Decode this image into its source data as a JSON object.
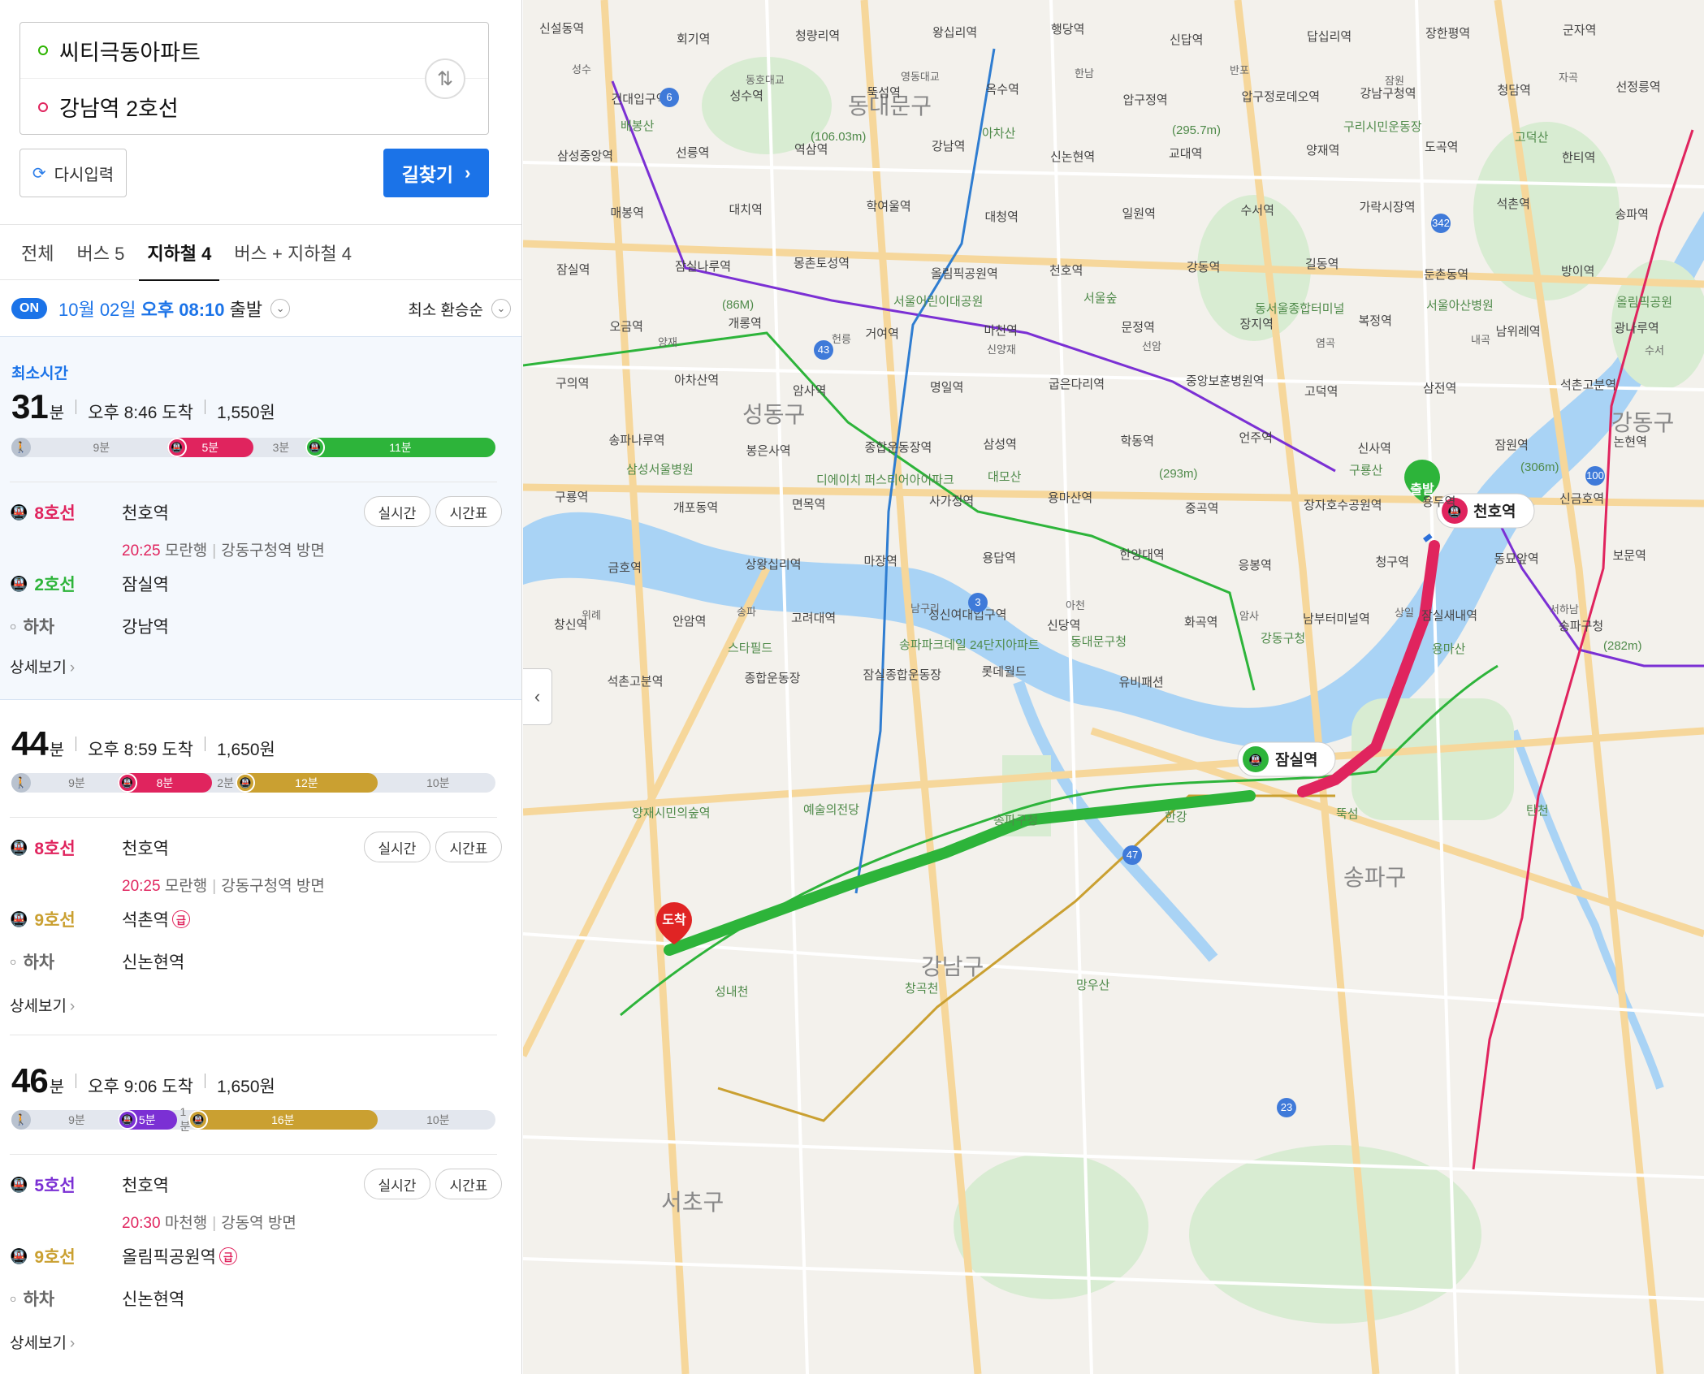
{
  "search": {
    "origin": "씨티극동아파트",
    "destination": "강남역 2호선",
    "reset_label": "다시입력",
    "find_label": "길찾기"
  },
  "tabs": [
    "전체",
    "버스 5",
    "지하철 4",
    "버스 + 지하철 4"
  ],
  "active_tab": 2,
  "departure": {
    "on_label": "ON",
    "date": "10월 02일",
    "time": "오후 08:10",
    "suffix": "출발",
    "sort": "최소 환승순"
  },
  "routes": [
    {
      "badge": "최소시간",
      "minutes": "31",
      "unit": "분",
      "arrival": "오후 8:46 도착",
      "fare": "1,550원",
      "timeline": [
        {
          "type": "walk",
          "label": "9분",
          "minutes": 9
        },
        {
          "type": "line8",
          "label": "5분",
          "minutes": 5
        },
        {
          "type": "walk",
          "label": "3분",
          "minutes": 3
        },
        {
          "type": "line2",
          "label": "11분",
          "minutes": 11
        }
      ],
      "steps": [
        {
          "line": "8호선",
          "station": "천호역",
          "time": "20:25",
          "dir": "모란행",
          "exit": "강동구청역 방면",
          "realtime": "실시간",
          "timetable": "시간표"
        },
        {
          "line": "2호선",
          "station": "잠실역"
        },
        {
          "line": "하차",
          "station": "강남역"
        }
      ],
      "detail": "상세보기"
    },
    {
      "minutes": "44",
      "unit": "분",
      "arrival": "오후 8:59 도착",
      "fare": "1,650원",
      "timeline": [
        {
          "type": "walk",
          "label": "9분",
          "minutes": 9
        },
        {
          "type": "line8",
          "label": "8분",
          "minutes": 8
        },
        {
          "type": "walk",
          "label": "2분",
          "minutes": 2
        },
        {
          "type": "line9",
          "label": "12분",
          "minutes": 12
        },
        {
          "type": "walk",
          "label": "10분",
          "minutes": 10
        }
      ],
      "steps": [
        {
          "line": "8호선",
          "station": "천호역",
          "time": "20:25",
          "dir": "모란행",
          "exit": "강동구청역 방면",
          "realtime": "실시간",
          "timetable": "시간표"
        },
        {
          "line": "9호선",
          "station": "석촌역",
          "express": "급"
        },
        {
          "line": "하차",
          "station": "신논현역"
        }
      ],
      "detail": "상세보기"
    },
    {
      "minutes": "46",
      "unit": "분",
      "arrival": "오후 9:06 도착",
      "fare": "1,650원",
      "timeline": [
        {
          "type": "walk",
          "label": "9분",
          "minutes": 9
        },
        {
          "type": "line5",
          "label": "5분",
          "minutes": 5
        },
        {
          "type": "walk",
          "label": "1분",
          "minutes": 1
        },
        {
          "type": "line9",
          "label": "16분",
          "minutes": 16
        },
        {
          "type": "walk",
          "label": "10분",
          "minutes": 10
        }
      ],
      "steps": [
        {
          "line": "5호선",
          "station": "천호역",
          "time": "20:30",
          "dir": "마천행",
          "exit": "강동역 방면",
          "realtime": "실시간",
          "timetable": "시간표"
        },
        {
          "line": "9호선",
          "station": "올림픽공원역",
          "express": "급"
        },
        {
          "line": "하차",
          "station": "신논현역"
        }
      ],
      "detail": "상세보기"
    }
  ],
  "colors": {
    "line2": "#2db43a",
    "line5": "#7b30d4",
    "line8": "#e0245e",
    "line9": "#caa031",
    "accent": "#1b73e8",
    "river": "#a9d3f5"
  },
  "map": {
    "markers": {
      "start": "출발",
      "end": "도착",
      "cheonho": "천호역",
      "jamsil": "잠실역"
    },
    "districts": [
      "동대문구",
      "성동구",
      "강남구",
      "서초구",
      "송파구",
      "강동구"
    ],
    "stations": [
      "신설동역",
      "회기역",
      "청량리역",
      "왕십리역",
      "행당역",
      "신답역",
      "답십리역",
      "장한평역",
      "군자역",
      "건대입구역",
      "성수역",
      "뚝섬역",
      "옥수역",
      "압구정역",
      "압구정로데오역",
      "강남구청역",
      "청담역",
      "선정릉역",
      "삼성중앙역",
      "선릉역",
      "역삼역",
      "강남역",
      "신논현역",
      "교대역",
      "양재역",
      "도곡역",
      "한티역",
      "매봉역",
      "대치역",
      "학여울역",
      "대청역",
      "일원역",
      "수서역",
      "가락시장역",
      "석촌역",
      "송파역",
      "잠실역",
      "잠실나루역",
      "몽촌토성역",
      "올림픽공원역",
      "천호역",
      "강동역",
      "길동역",
      "둔촌동역",
      "방이역",
      "오금역",
      "개롱역",
      "거여역",
      "마천역",
      "문정역",
      "장지역",
      "복정역",
      "남위례역",
      "광나루역",
      "구의역",
      "아차산역",
      "암사역",
      "명일역",
      "굽은다리역",
      "중앙보훈병원역",
      "고덕역",
      "삼전역",
      "석촌고분역",
      "송파나루역",
      "봉은사역",
      "종합운동장역",
      "삼성역",
      "학동역",
      "언주역",
      "신사역",
      "잠원역",
      "논현역",
      "구룡역",
      "개포동역",
      "면목역",
      "사가정역",
      "용마산역",
      "중곡역",
      "장자호수공원역",
      "용두역",
      "신금호역",
      "금호역",
      "상왕십리역",
      "마장역",
      "용답역",
      "한양대역",
      "응봉역",
      "청구역",
      "동묘앞역",
      "보문역",
      "창신역",
      "안암역",
      "고려대역",
      "성신여대입구역",
      "신당역",
      "화곡역",
      "남부터미널역",
      "잠실새내역",
      "송파구청",
      "석촌고분역",
      "종합운동장",
      "잠실종합운동장",
      "롯데월드",
      "유비패션"
    ],
    "landmarks": [
      "배봉산",
      "(106.03m)",
      "아차산",
      "(295.7m)",
      "구리시민운동장",
      "고덕산",
      "(86M)",
      "서울어린이대공원",
      "서울숲",
      "동서울종합터미널",
      "서울아산병원",
      "올림픽공원",
      "삼성서울병원",
      "디에이치 퍼스티어아이파크",
      "대모산",
      "(293m)",
      "구룡산",
      "(306m)",
      "스타필드",
      "송파파크데일 24단지아파트",
      "동대문구청",
      "강동구청",
      "용마산",
      "(282m)",
      "양재시민의숲역",
      "예술의전당",
      "송파구청",
      "한강",
      "뚝섬",
      "탄천",
      "성내천",
      "창곡천",
      "망우산"
    ],
    "roads": [
      "성수",
      "동호대교",
      "영동대교",
      "한남",
      "반포",
      "잠원",
      "자곡",
      "양재",
      "헌릉",
      "신양재",
      "선암",
      "염곡",
      "내곡",
      "수서",
      "위례",
      "송파",
      "남구리",
      "아천",
      "암사",
      "상일",
      "서하남"
    ],
    "route_labels": [
      "6",
      "43",
      "3",
      "47",
      "23",
      "342",
      "100"
    ]
  }
}
